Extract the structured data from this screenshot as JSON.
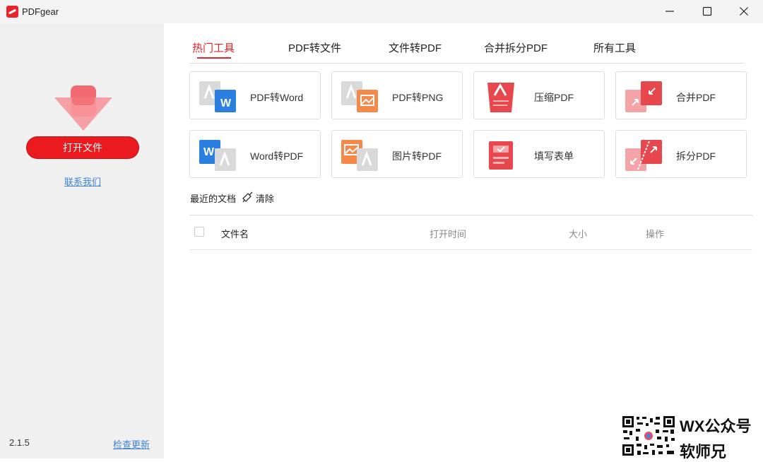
{
  "app": {
    "title": "PDFgear",
    "version": "2.1.5"
  },
  "sidebar": {
    "open_button": "打开文件",
    "contact_link": "联系我们",
    "check_update_link": "检查更新"
  },
  "tabs": [
    {
      "label": "热门工具",
      "active": true
    },
    {
      "label": "PDF转文件",
      "active": false
    },
    {
      "label": "文件转PDF",
      "active": false
    },
    {
      "label": "合并拆分PDF",
      "active": false
    },
    {
      "label": "所有工具",
      "active": false
    }
  ],
  "tools": [
    {
      "label": "PDF转Word",
      "icon": "pdf-to-word-icon"
    },
    {
      "label": "PDF转PNG",
      "icon": "pdf-to-png-icon"
    },
    {
      "label": "压缩PDF",
      "icon": "compress-pdf-icon"
    },
    {
      "label": "合并PDF",
      "icon": "merge-pdf-icon"
    },
    {
      "label": "Word转PDF",
      "icon": "word-to-pdf-icon"
    },
    {
      "label": "图片转PDF",
      "icon": "image-to-pdf-icon"
    },
    {
      "label": "填写表单",
      "icon": "fill-form-icon"
    },
    {
      "label": "拆分PDF",
      "icon": "split-pdf-icon"
    }
  ],
  "recent": {
    "title": "最近的文档",
    "clear": "清除",
    "columns": {
      "name": "文件名",
      "time": "打开时间",
      "size": "大小",
      "actions": "操作"
    }
  },
  "watermark": {
    "line1": "WX公众号",
    "line2": "软师兄"
  },
  "colors": {
    "accent": "#e0242b",
    "sidebar_bg": "#f0f0f0",
    "link": "#3f84d4"
  }
}
